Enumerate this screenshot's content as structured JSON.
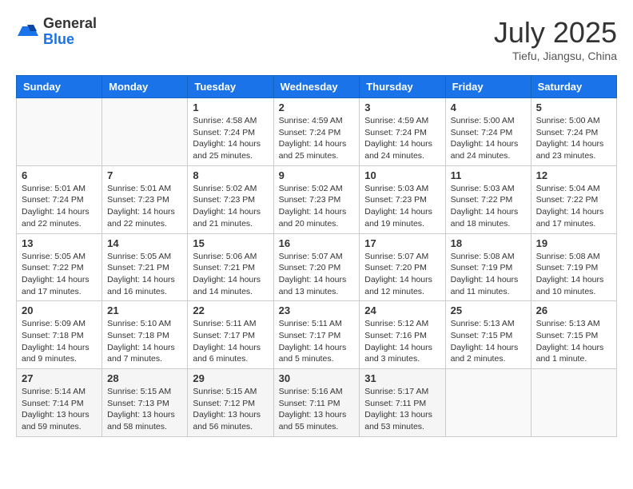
{
  "header": {
    "logo_general": "General",
    "logo_blue": "Blue",
    "title": "July 2025",
    "location": "Tiefu, Jiangsu, China"
  },
  "weekdays": [
    "Sunday",
    "Monday",
    "Tuesday",
    "Wednesday",
    "Thursday",
    "Friday",
    "Saturday"
  ],
  "weeks": [
    [
      {
        "day": "",
        "info": ""
      },
      {
        "day": "",
        "info": ""
      },
      {
        "day": "1",
        "info": "Sunrise: 4:58 AM\nSunset: 7:24 PM\nDaylight: 14 hours and 25 minutes."
      },
      {
        "day": "2",
        "info": "Sunrise: 4:59 AM\nSunset: 7:24 PM\nDaylight: 14 hours and 25 minutes."
      },
      {
        "day": "3",
        "info": "Sunrise: 4:59 AM\nSunset: 7:24 PM\nDaylight: 14 hours and 24 minutes."
      },
      {
        "day": "4",
        "info": "Sunrise: 5:00 AM\nSunset: 7:24 PM\nDaylight: 14 hours and 24 minutes."
      },
      {
        "day": "5",
        "info": "Sunrise: 5:00 AM\nSunset: 7:24 PM\nDaylight: 14 hours and 23 minutes."
      }
    ],
    [
      {
        "day": "6",
        "info": "Sunrise: 5:01 AM\nSunset: 7:24 PM\nDaylight: 14 hours and 22 minutes."
      },
      {
        "day": "7",
        "info": "Sunrise: 5:01 AM\nSunset: 7:23 PM\nDaylight: 14 hours and 22 minutes."
      },
      {
        "day": "8",
        "info": "Sunrise: 5:02 AM\nSunset: 7:23 PM\nDaylight: 14 hours and 21 minutes."
      },
      {
        "day": "9",
        "info": "Sunrise: 5:02 AM\nSunset: 7:23 PM\nDaylight: 14 hours and 20 minutes."
      },
      {
        "day": "10",
        "info": "Sunrise: 5:03 AM\nSunset: 7:23 PM\nDaylight: 14 hours and 19 minutes."
      },
      {
        "day": "11",
        "info": "Sunrise: 5:03 AM\nSunset: 7:22 PM\nDaylight: 14 hours and 18 minutes."
      },
      {
        "day": "12",
        "info": "Sunrise: 5:04 AM\nSunset: 7:22 PM\nDaylight: 14 hours and 17 minutes."
      }
    ],
    [
      {
        "day": "13",
        "info": "Sunrise: 5:05 AM\nSunset: 7:22 PM\nDaylight: 14 hours and 17 minutes."
      },
      {
        "day": "14",
        "info": "Sunrise: 5:05 AM\nSunset: 7:21 PM\nDaylight: 14 hours and 16 minutes."
      },
      {
        "day": "15",
        "info": "Sunrise: 5:06 AM\nSunset: 7:21 PM\nDaylight: 14 hours and 14 minutes."
      },
      {
        "day": "16",
        "info": "Sunrise: 5:07 AM\nSunset: 7:20 PM\nDaylight: 14 hours and 13 minutes."
      },
      {
        "day": "17",
        "info": "Sunrise: 5:07 AM\nSunset: 7:20 PM\nDaylight: 14 hours and 12 minutes."
      },
      {
        "day": "18",
        "info": "Sunrise: 5:08 AM\nSunset: 7:19 PM\nDaylight: 14 hours and 11 minutes."
      },
      {
        "day": "19",
        "info": "Sunrise: 5:08 AM\nSunset: 7:19 PM\nDaylight: 14 hours and 10 minutes."
      }
    ],
    [
      {
        "day": "20",
        "info": "Sunrise: 5:09 AM\nSunset: 7:18 PM\nDaylight: 14 hours and 9 minutes."
      },
      {
        "day": "21",
        "info": "Sunrise: 5:10 AM\nSunset: 7:18 PM\nDaylight: 14 hours and 7 minutes."
      },
      {
        "day": "22",
        "info": "Sunrise: 5:11 AM\nSunset: 7:17 PM\nDaylight: 14 hours and 6 minutes."
      },
      {
        "day": "23",
        "info": "Sunrise: 5:11 AM\nSunset: 7:17 PM\nDaylight: 14 hours and 5 minutes."
      },
      {
        "day": "24",
        "info": "Sunrise: 5:12 AM\nSunset: 7:16 PM\nDaylight: 14 hours and 3 minutes."
      },
      {
        "day": "25",
        "info": "Sunrise: 5:13 AM\nSunset: 7:15 PM\nDaylight: 14 hours and 2 minutes."
      },
      {
        "day": "26",
        "info": "Sunrise: 5:13 AM\nSunset: 7:15 PM\nDaylight: 14 hours and 1 minute."
      }
    ],
    [
      {
        "day": "27",
        "info": "Sunrise: 5:14 AM\nSunset: 7:14 PM\nDaylight: 13 hours and 59 minutes."
      },
      {
        "day": "28",
        "info": "Sunrise: 5:15 AM\nSunset: 7:13 PM\nDaylight: 13 hours and 58 minutes."
      },
      {
        "day": "29",
        "info": "Sunrise: 5:15 AM\nSunset: 7:12 PM\nDaylight: 13 hours and 56 minutes."
      },
      {
        "day": "30",
        "info": "Sunrise: 5:16 AM\nSunset: 7:11 PM\nDaylight: 13 hours and 55 minutes."
      },
      {
        "day": "31",
        "info": "Sunrise: 5:17 AM\nSunset: 7:11 PM\nDaylight: 13 hours and 53 minutes."
      },
      {
        "day": "",
        "info": ""
      },
      {
        "day": "",
        "info": ""
      }
    ]
  ]
}
